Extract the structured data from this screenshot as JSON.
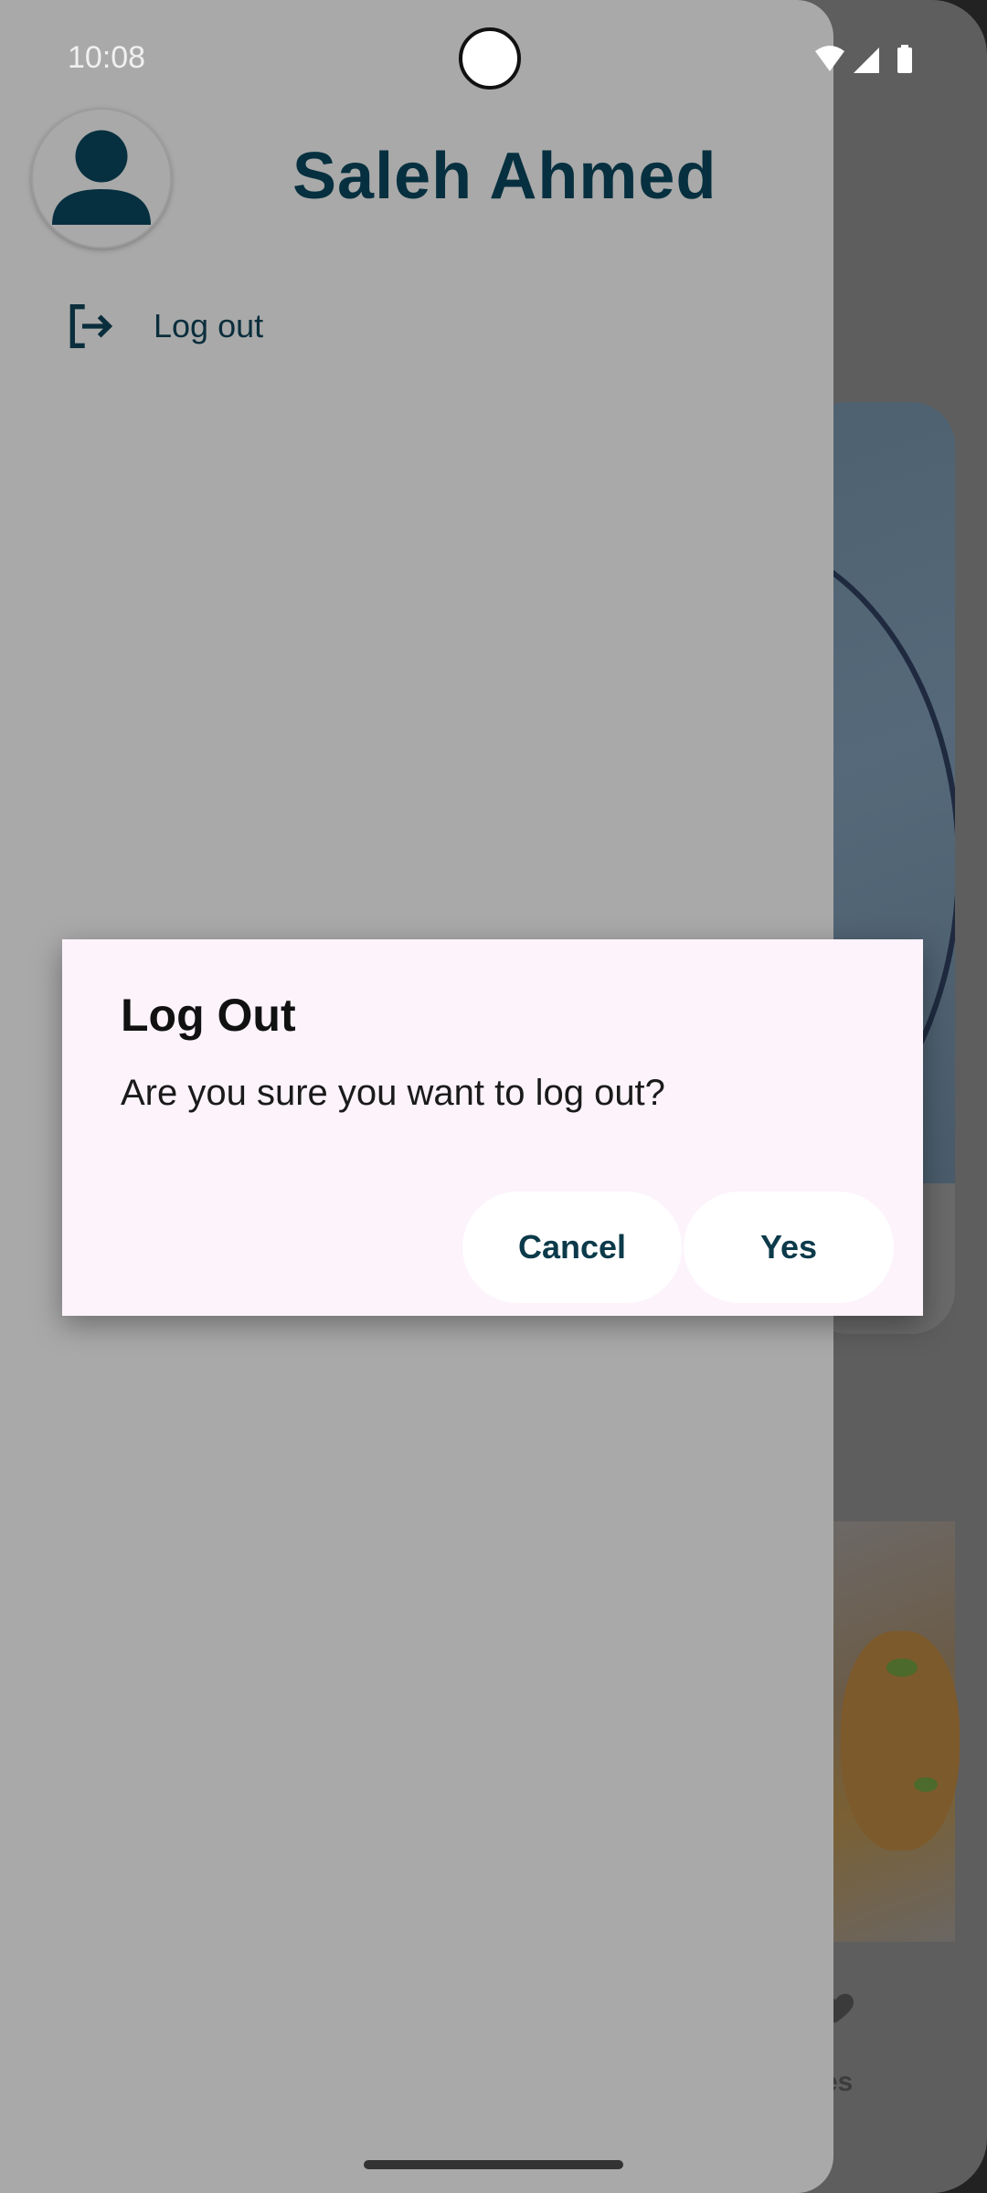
{
  "status_bar": {
    "time": "10:08"
  },
  "drawer": {
    "user_name": "Saleh Ahmed",
    "logout_label": "Log out"
  },
  "background": {
    "nav_partial_label": "rites"
  },
  "dialog": {
    "title": "Log Out",
    "message": "Are you sure you want to log out?",
    "cancel_label": "Cancel",
    "confirm_label": "Yes"
  },
  "colors": {
    "primary": "#06303f",
    "dialog_bg": "#fcf3fb",
    "scrim": "#a9a9a9"
  }
}
